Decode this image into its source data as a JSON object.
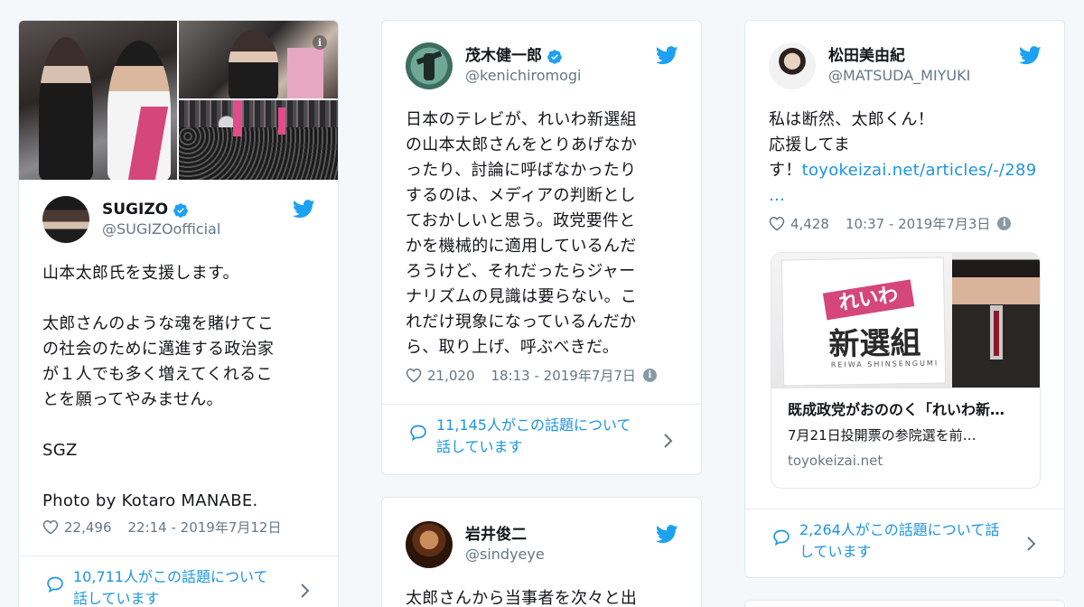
{
  "tweets": [
    {
      "name": "SUGIZO",
      "handle": "@SUGIZOofficial",
      "text": "山本太郎氏を支援します。\n\n太郎さんのような魂を賭けてこ\nの社会のために邁進する政治家\nが１人でも多く増えてくれるこ\nとを願ってやみません。\n\nSGZ\n\nPhoto by Kotaro MANABE.",
      "likes": "22,496",
      "time": "22:14 - 2019年7月12日",
      "talk_line1": "10,711人がこの話題について",
      "talk_line2": "話しています"
    },
    {
      "name": "茂木健一郎",
      "handle": "@kenichiromogi",
      "text": "日本のテレビが、れいわ新選組\nの山本太郎さんをとりあげなか\nったり、討論に呼ばなかったり\nするのは、メディアの判断とし\nておかしいと思う。政党要件と\nかを機械的に適用しているんだ\nろうけど、それだったらジャー\nナリズムの見識は要らない。こ\nれだけ現象になっているんだか\nら、取り上げ、呼ぶべきだ。",
      "likes": "21,020",
      "time": "18:13 - 2019年7月7日",
      "talk_line1": "11,145人がこの話題について",
      "talk_line2": "話しています"
    },
    {
      "name": "岩井俊二",
      "handle": "@sindyeye",
      "text": "太郎さんから当事者を次々と出"
    },
    {
      "name": "松田美由紀",
      "handle": "@MATSUDA_MIYUKI",
      "text_line1": "私は断然、太郎くん！",
      "text_line2": "応援してま",
      "text_line3_prefix": "す！",
      "link": "toyokeizai.net/articles/-/289",
      "ellipsis": "…",
      "likes": "4,428",
      "time": "10:37 - 2019年7月3日",
      "card_title": "既成政党がおののく「れいわ新…",
      "card_desc": "7月21日投開票の参院選を前…",
      "card_domain": "toyokeizai.net",
      "talk_line1": "2,264人がこの話題について話",
      "talk_line2": "しています"
    }
  ],
  "card_image_text": {
    "reiwa": "れいわ",
    "shinsengumi": "新選組",
    "romaji": "REIWA SHINSENGUMI"
  },
  "colors": {
    "blue": "#1da1f2",
    "link": "#1b95e0",
    "muted": "#657786",
    "border": "#e1e8ed",
    "brand_pink": "#d5467a"
  },
  "icons": [
    "verified-badge-icon",
    "twitter-bird-icon",
    "heart-icon",
    "info-icon",
    "speech-bubble-icon",
    "chevron-right-icon"
  ]
}
